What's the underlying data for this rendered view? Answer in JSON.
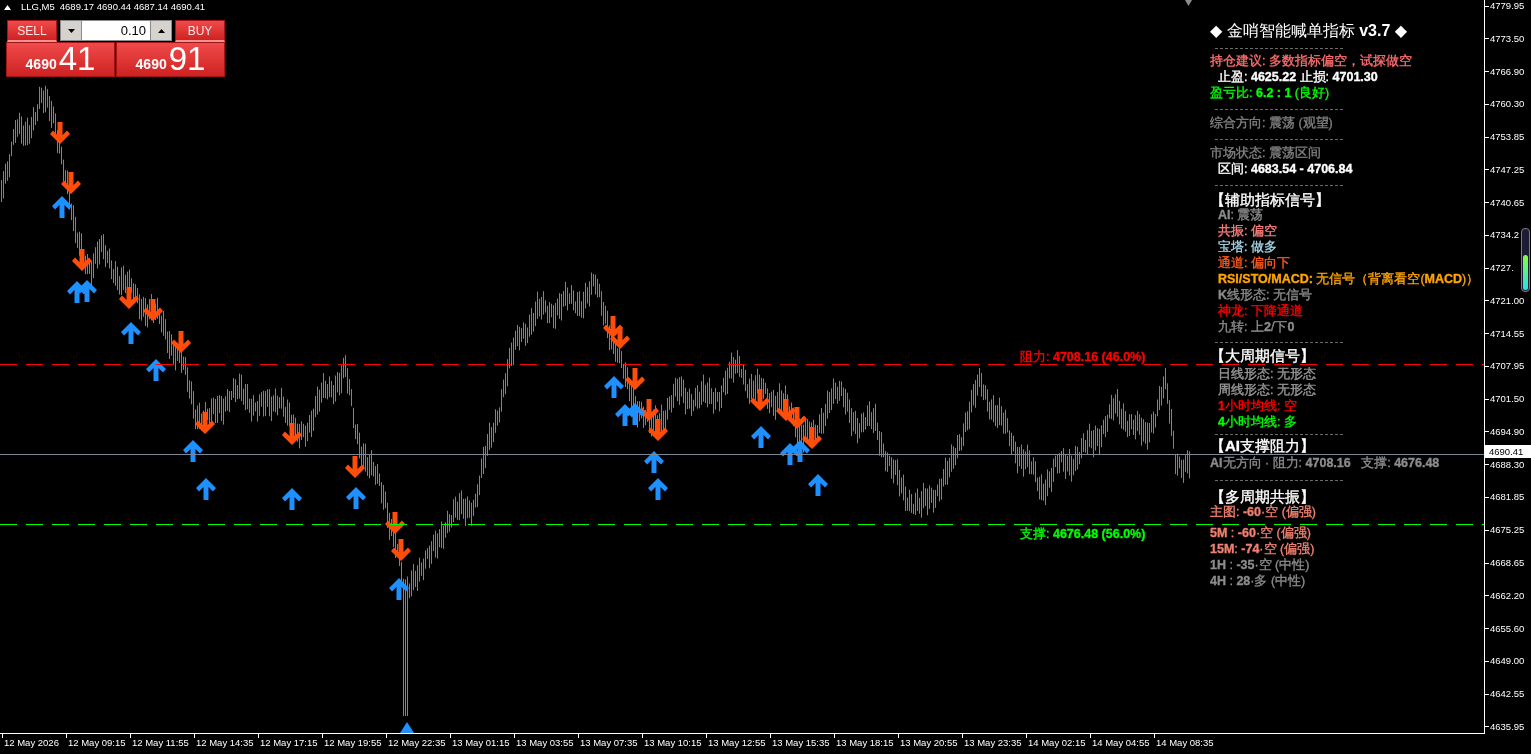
{
  "chart_header": {
    "symbol": "LLG,M5",
    "quote": "4689.17 4690.44 4687.14 4690.41"
  },
  "trade_panel": {
    "sell": {
      "label": "SELL",
      "price_prefix": "4690",
      "price_digits": "41"
    },
    "volume": "0.10",
    "buy": {
      "label": "BUY",
      "price_prefix": "4690",
      "price_digits": "91"
    }
  },
  "indicator_panel": {
    "title": "◆ 金哨智能喊单指标 **v3.7** ◆",
    "sections": [
      {
        "lines": [
          {
            "kind": "line",
            "text": "持仓建议: 多数指标偏空，试探做空",
            "color": "#ff6e6e"
          },
          {
            "kind": "item",
            "text": "止盈: **4625.22** 止损: **4701.30**",
            "color": "#ffffff"
          },
          {
            "kind": "line",
            "text": "盈亏比: **6.2 : 1** (良好)",
            "color": "#00ff00"
          }
        ]
      },
      {
        "lines": [
          {
            "kind": "line",
            "text": "综合方向: 震荡 (观望)",
            "color": "#808080"
          }
        ]
      },
      {
        "lines": [
          {
            "kind": "line",
            "text": "市场状态: 震荡区间",
            "color": "#808080"
          },
          {
            "kind": "item",
            "text": "区间: **4683.54 - 4706.84**",
            "color": "#ffffff"
          }
        ]
      },
      {
        "lines": [
          {
            "kind": "heading",
            "text": "【辅助指标信号】",
            "color": "#ffffff"
          },
          {
            "kind": "item",
            "text": "**AI**: 震荡",
            "color": "#8c8c8c"
          },
          {
            "kind": "item",
            "text": "共振: 偏空",
            "color": "#ff7f7f"
          },
          {
            "kind": "item",
            "text": "宝塔: 做多",
            "color": "#a8d8ea"
          },
          {
            "kind": "item",
            "text": "通道: 偏向下",
            "color": "#ff5a1e"
          },
          {
            "kind": "item",
            "text": "**RSI/STO/MACD:** 无信号（背离看空(**MACD**)）",
            "color": "#ffa500"
          },
          {
            "kind": "item",
            "text": "**K**线形态: 无信号",
            "color": "#8c8c8c"
          },
          {
            "kind": "item",
            "text": "神龙: 下降通道",
            "color": "#ff0000"
          },
          {
            "kind": "item",
            "text": "九转: 上**2**/下**0**",
            "color": "#8c8c8c"
          }
        ]
      },
      {
        "lines": [
          {
            "kind": "heading",
            "text": "【大周期信号】",
            "color": "#ffffff"
          },
          {
            "kind": "item",
            "text": "日线形态: 无形态",
            "color": "#999999"
          },
          {
            "kind": "item",
            "text": "周线形态: 无形态",
            "color": "#999999"
          },
          {
            "kind": "item",
            "text": "**1**小时均线: 空",
            "color": "#ff0000"
          },
          {
            "kind": "item",
            "text": "**4**小时均线: 多",
            "color": "#00ff00"
          }
        ]
      },
      {
        "lines": [
          {
            "kind": "heading",
            "text": "【**AI**支撑阻力】",
            "color": "#ffffff"
          },
          {
            "kind": "line",
            "text": "**AI**无方向 · 阻力: **4708.16**   支撑: **4676.48**",
            "color": "#8c8c8c"
          }
        ]
      },
      {
        "lines": [
          {
            "kind": "heading",
            "text": "【多周期共振】",
            "color": "#ffffff"
          },
          {
            "kind": "line",
            "text": "主图: **-60**·空 (偏强)",
            "color": "#f08070"
          },
          {
            "kind": "line",
            "text": "**5M** : **-60**·空 (偏强)",
            "color": "#f08070"
          },
          {
            "kind": "line",
            "text": "**15M**: **-74**·空 (偏强)",
            "color": "#f08070"
          },
          {
            "kind": "line",
            "text": "**1H** : **-35**·空 (中性)",
            "color": "#8c8c8c"
          },
          {
            "kind": "line",
            "text": "**4H** : **28**·多 (中性)",
            "color": "#8c8c8c"
          }
        ]
      }
    ]
  },
  "level_lines": [
    {
      "kind": "resistance",
      "label": "阻力: **4708.16 (46.0%)**",
      "color": "#ff0000"
    },
    {
      "kind": "support",
      "label": "支撑: **4676.48 (56.0%)**",
      "color": "#00ff00"
    }
  ],
  "price_axis": {
    "labels": [
      "4779.95",
      "4773.50",
      "4766.90",
      "4760.30",
      "4753.85",
      "4747.25",
      "4740.65",
      "4734.2",
      "4727.",
      "4721.00",
      "4714.55",
      "4707.95",
      "4701.50",
      "4694.90",
      "4688.30",
      "4681.85",
      "4675.25",
      "4668.65",
      "4662.20",
      "4655.60",
      "4649.00",
      "4642.55",
      "4635.95"
    ],
    "current_price": "4690.41",
    "meter": {
      "level": 0.58
    }
  },
  "time_axis": {
    "labels": [
      "12 May 2026",
      "12 May 09:15",
      "12 May 11:55",
      "12 May 14:35",
      "12 May 17:15",
      "12 May 19:55",
      "12 May 22:35",
      "13 May 01:15",
      "13 May 03:55",
      "13 May 07:35",
      "13 May 10:15",
      "13 May 12:55",
      "13 May 15:35",
      "13 May 18:15",
      "13 May 20:55",
      "13 May 23:35",
      "14 May 02:15",
      "14 May 04:55",
      "14 May 08:35"
    ]
  }
}
